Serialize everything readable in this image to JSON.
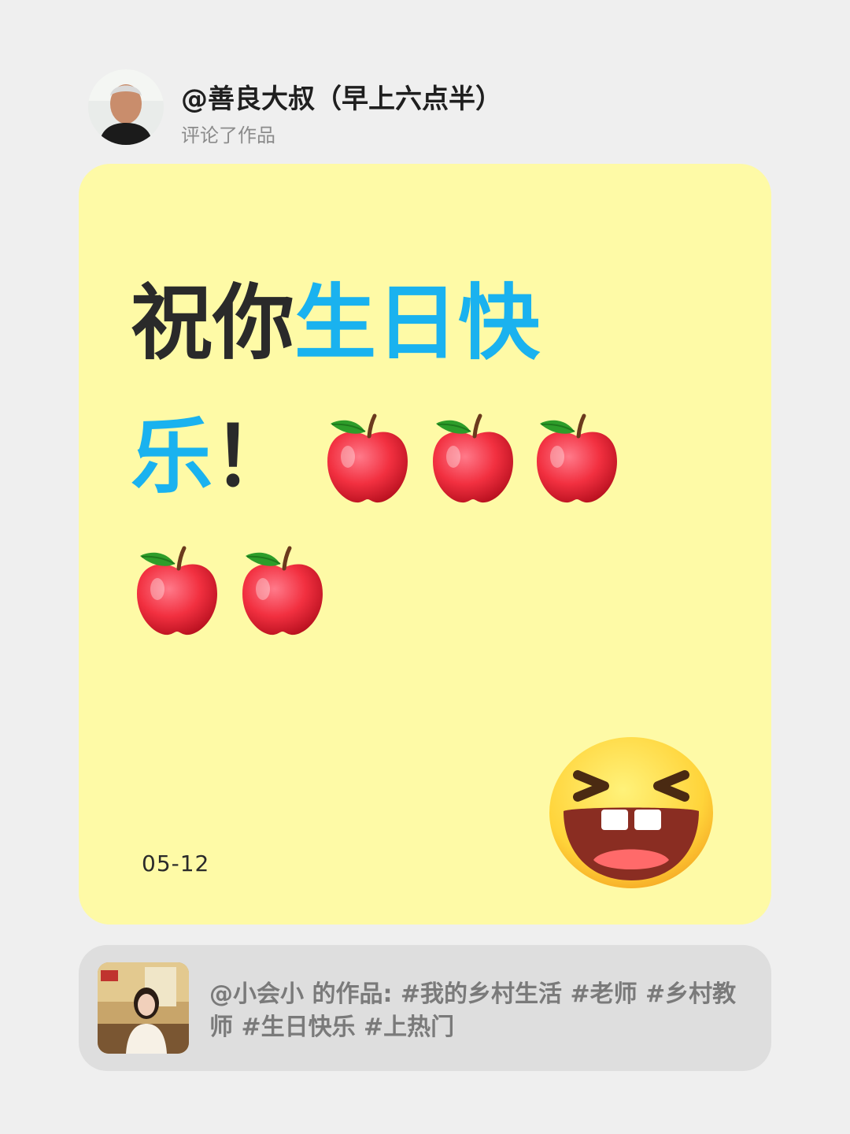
{
  "comment_header": {
    "username": "@善良大叔（早上六点半）",
    "action": "评论了作品"
  },
  "comment_card": {
    "message_parts": [
      {
        "text": "祝你",
        "color": "#2a2a2a"
      },
      {
        "text": "生日快",
        "color": "#1ab2ef"
      },
      {
        "text": "乐",
        "color": "#1ab2ef"
      },
      {
        "text": "！",
        "color": "#2a2a2a"
      }
    ],
    "emojis": [
      "apple-emoji",
      "apple-emoji",
      "apple-emoji",
      "apple-emoji",
      "apple-emoji"
    ],
    "date": "05-12",
    "sticker": "laughing-face-emoji",
    "background_color": "#fefaa6"
  },
  "referenced_work": {
    "text": "@小会小 的作品: #我的乡村生活 #老师 #乡村教师 #生日快乐 #上热门"
  }
}
